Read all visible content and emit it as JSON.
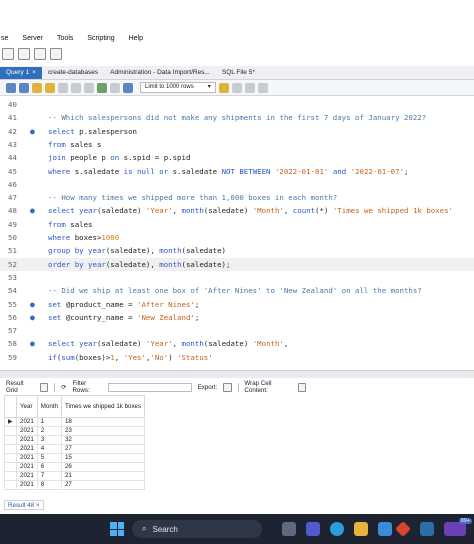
{
  "menu": [
    "se",
    "Server",
    "Tools",
    "Scripting",
    "Help"
  ],
  "tabs": [
    {
      "label": "Query 1",
      "close": "×",
      "active": true
    },
    {
      "label": "create-databases",
      "active": false
    },
    {
      "label": "Administration - Data Import/Res...",
      "active": false
    },
    {
      "label": "SQL File 5*",
      "active": false
    }
  ],
  "toolbar": {
    "limit_label": "Limit to 1000 rows",
    "limit_arrow": "▾"
  },
  "editor": {
    "lines": [
      {
        "n": "40",
        "dot": false,
        "parts": []
      },
      {
        "n": "41",
        "dot": false,
        "parts": [
          [
            "cmt",
            "-- Which salespersons did not make any shipments in the first 7 days of January 2022?"
          ]
        ]
      },
      {
        "n": "42",
        "dot": true,
        "parts": [
          [
            "kw",
            "select "
          ],
          [
            "id",
            "p.salesperson"
          ]
        ]
      },
      {
        "n": "43",
        "dot": false,
        "parts": [
          [
            "kw",
            "from "
          ],
          [
            "id",
            "sales s"
          ]
        ]
      },
      {
        "n": "44",
        "dot": false,
        "parts": [
          [
            "kw",
            "join "
          ],
          [
            "id",
            "people p "
          ],
          [
            "kw",
            "on "
          ],
          [
            "id",
            "s.spid = p.spid"
          ]
        ]
      },
      {
        "n": "45",
        "dot": false,
        "parts": [
          [
            "kw",
            "where "
          ],
          [
            "id",
            "s.saledate "
          ],
          [
            "kw",
            "is null or "
          ],
          [
            "id",
            "s.saledate "
          ],
          [
            "kw",
            "NOT BETWEEN "
          ],
          [
            "str",
            "'2022-01-01'"
          ],
          [
            "kw",
            " and "
          ],
          [
            "str",
            "'2022-01-07'"
          ],
          [
            "id",
            ";"
          ]
        ]
      },
      {
        "n": "46",
        "dot": false,
        "parts": []
      },
      {
        "n": "47",
        "dot": false,
        "parts": [
          [
            "cmt",
            "-- How many times we shipped more than 1,000 boxes in each month?"
          ]
        ]
      },
      {
        "n": "48",
        "dot": true,
        "parts": [
          [
            "kw",
            "select "
          ],
          [
            "fn",
            "year"
          ],
          [
            "id",
            "(saledate) "
          ],
          [
            "str",
            "'Year'"
          ],
          [
            "id",
            ", "
          ],
          [
            "fn",
            "month"
          ],
          [
            "id",
            "(saledate) "
          ],
          [
            "str",
            "'Month'"
          ],
          [
            "id",
            ", "
          ],
          [
            "fn",
            "count"
          ],
          [
            "id",
            "(*) "
          ],
          [
            "str",
            "'Times we shipped 1k boxes'"
          ]
        ]
      },
      {
        "n": "49",
        "dot": false,
        "parts": [
          [
            "kw",
            "from "
          ],
          [
            "id",
            "sales"
          ]
        ]
      },
      {
        "n": "50",
        "dot": false,
        "parts": [
          [
            "kw",
            "where "
          ],
          [
            "id",
            "boxes>"
          ],
          [
            "num",
            "1000"
          ]
        ]
      },
      {
        "n": "51",
        "dot": false,
        "parts": [
          [
            "kw",
            "group by "
          ],
          [
            "fn",
            "year"
          ],
          [
            "id",
            "(saledate), "
          ],
          [
            "fn",
            "month"
          ],
          [
            "id",
            "(saledate)"
          ]
        ]
      },
      {
        "n": "52",
        "dot": false,
        "cur": true,
        "parts": [
          [
            "kw",
            "order by "
          ],
          [
            "fn",
            "year"
          ],
          [
            "id",
            "(saledate), "
          ],
          [
            "fn",
            "month"
          ],
          [
            "id",
            "(saledate);"
          ]
        ]
      },
      {
        "n": "53",
        "dot": false,
        "parts": []
      },
      {
        "n": "54",
        "dot": false,
        "parts": [
          [
            "cmt",
            "-- Did we ship at least one box of 'After Nines' to 'New Zealand' on all the months?"
          ]
        ]
      },
      {
        "n": "55",
        "dot": true,
        "parts": [
          [
            "kw",
            "set "
          ],
          [
            "id",
            "@product_name = "
          ],
          [
            "str",
            "'After Nines'"
          ],
          [
            "id",
            ";"
          ]
        ]
      },
      {
        "n": "56",
        "dot": true,
        "parts": [
          [
            "kw",
            "set "
          ],
          [
            "id",
            "@country_name = "
          ],
          [
            "str",
            "'New Zealand'"
          ],
          [
            "id",
            ";"
          ]
        ]
      },
      {
        "n": "57",
        "dot": false,
        "parts": []
      },
      {
        "n": "58",
        "dot": true,
        "parts": [
          [
            "kw",
            "select "
          ],
          [
            "fn",
            "year"
          ],
          [
            "id",
            "(saledate) "
          ],
          [
            "str",
            "'Year'"
          ],
          [
            "id",
            ", "
          ],
          [
            "fn",
            "month"
          ],
          [
            "id",
            "(saledate) "
          ],
          [
            "str",
            "'Month'"
          ],
          [
            "id",
            ","
          ]
        ]
      },
      {
        "n": "59",
        "dot": false,
        "parts": [
          [
            "fn",
            "if"
          ],
          [
            "id",
            "("
          ],
          [
            "fn",
            "sum"
          ],
          [
            "id",
            "(boxes)>"
          ],
          [
            "num",
            "1"
          ],
          [
            "id",
            ", "
          ],
          [
            "str",
            "'Yes'"
          ],
          [
            "id",
            ","
          ],
          [
            "str",
            "'No'"
          ],
          [
            "id",
            ") "
          ],
          [
            "str",
            "'Status'"
          ]
        ]
      }
    ]
  },
  "result": {
    "grid_label": "Result Grid",
    "filter_label": "Filter Rows:",
    "export_label": "Export:",
    "wrap_label": "Wrap Cell Content:",
    "columns": [
      "Year",
      "Month",
      "Times we shipped 1k boxes"
    ],
    "rows": [
      [
        "2021",
        "1",
        "18"
      ],
      [
        "2021",
        "2",
        "23"
      ],
      [
        "2021",
        "3",
        "32"
      ],
      [
        "2021",
        "4",
        "27"
      ],
      [
        "2021",
        "5",
        "15"
      ],
      [
        "2021",
        "6",
        "26"
      ],
      [
        "2021",
        "7",
        "21"
      ],
      [
        "2021",
        "8",
        "27"
      ]
    ],
    "result_tab": "Result 48",
    "result_tab_close": "×"
  },
  "taskbar": {
    "search_label": "Search",
    "badge": "99+"
  }
}
